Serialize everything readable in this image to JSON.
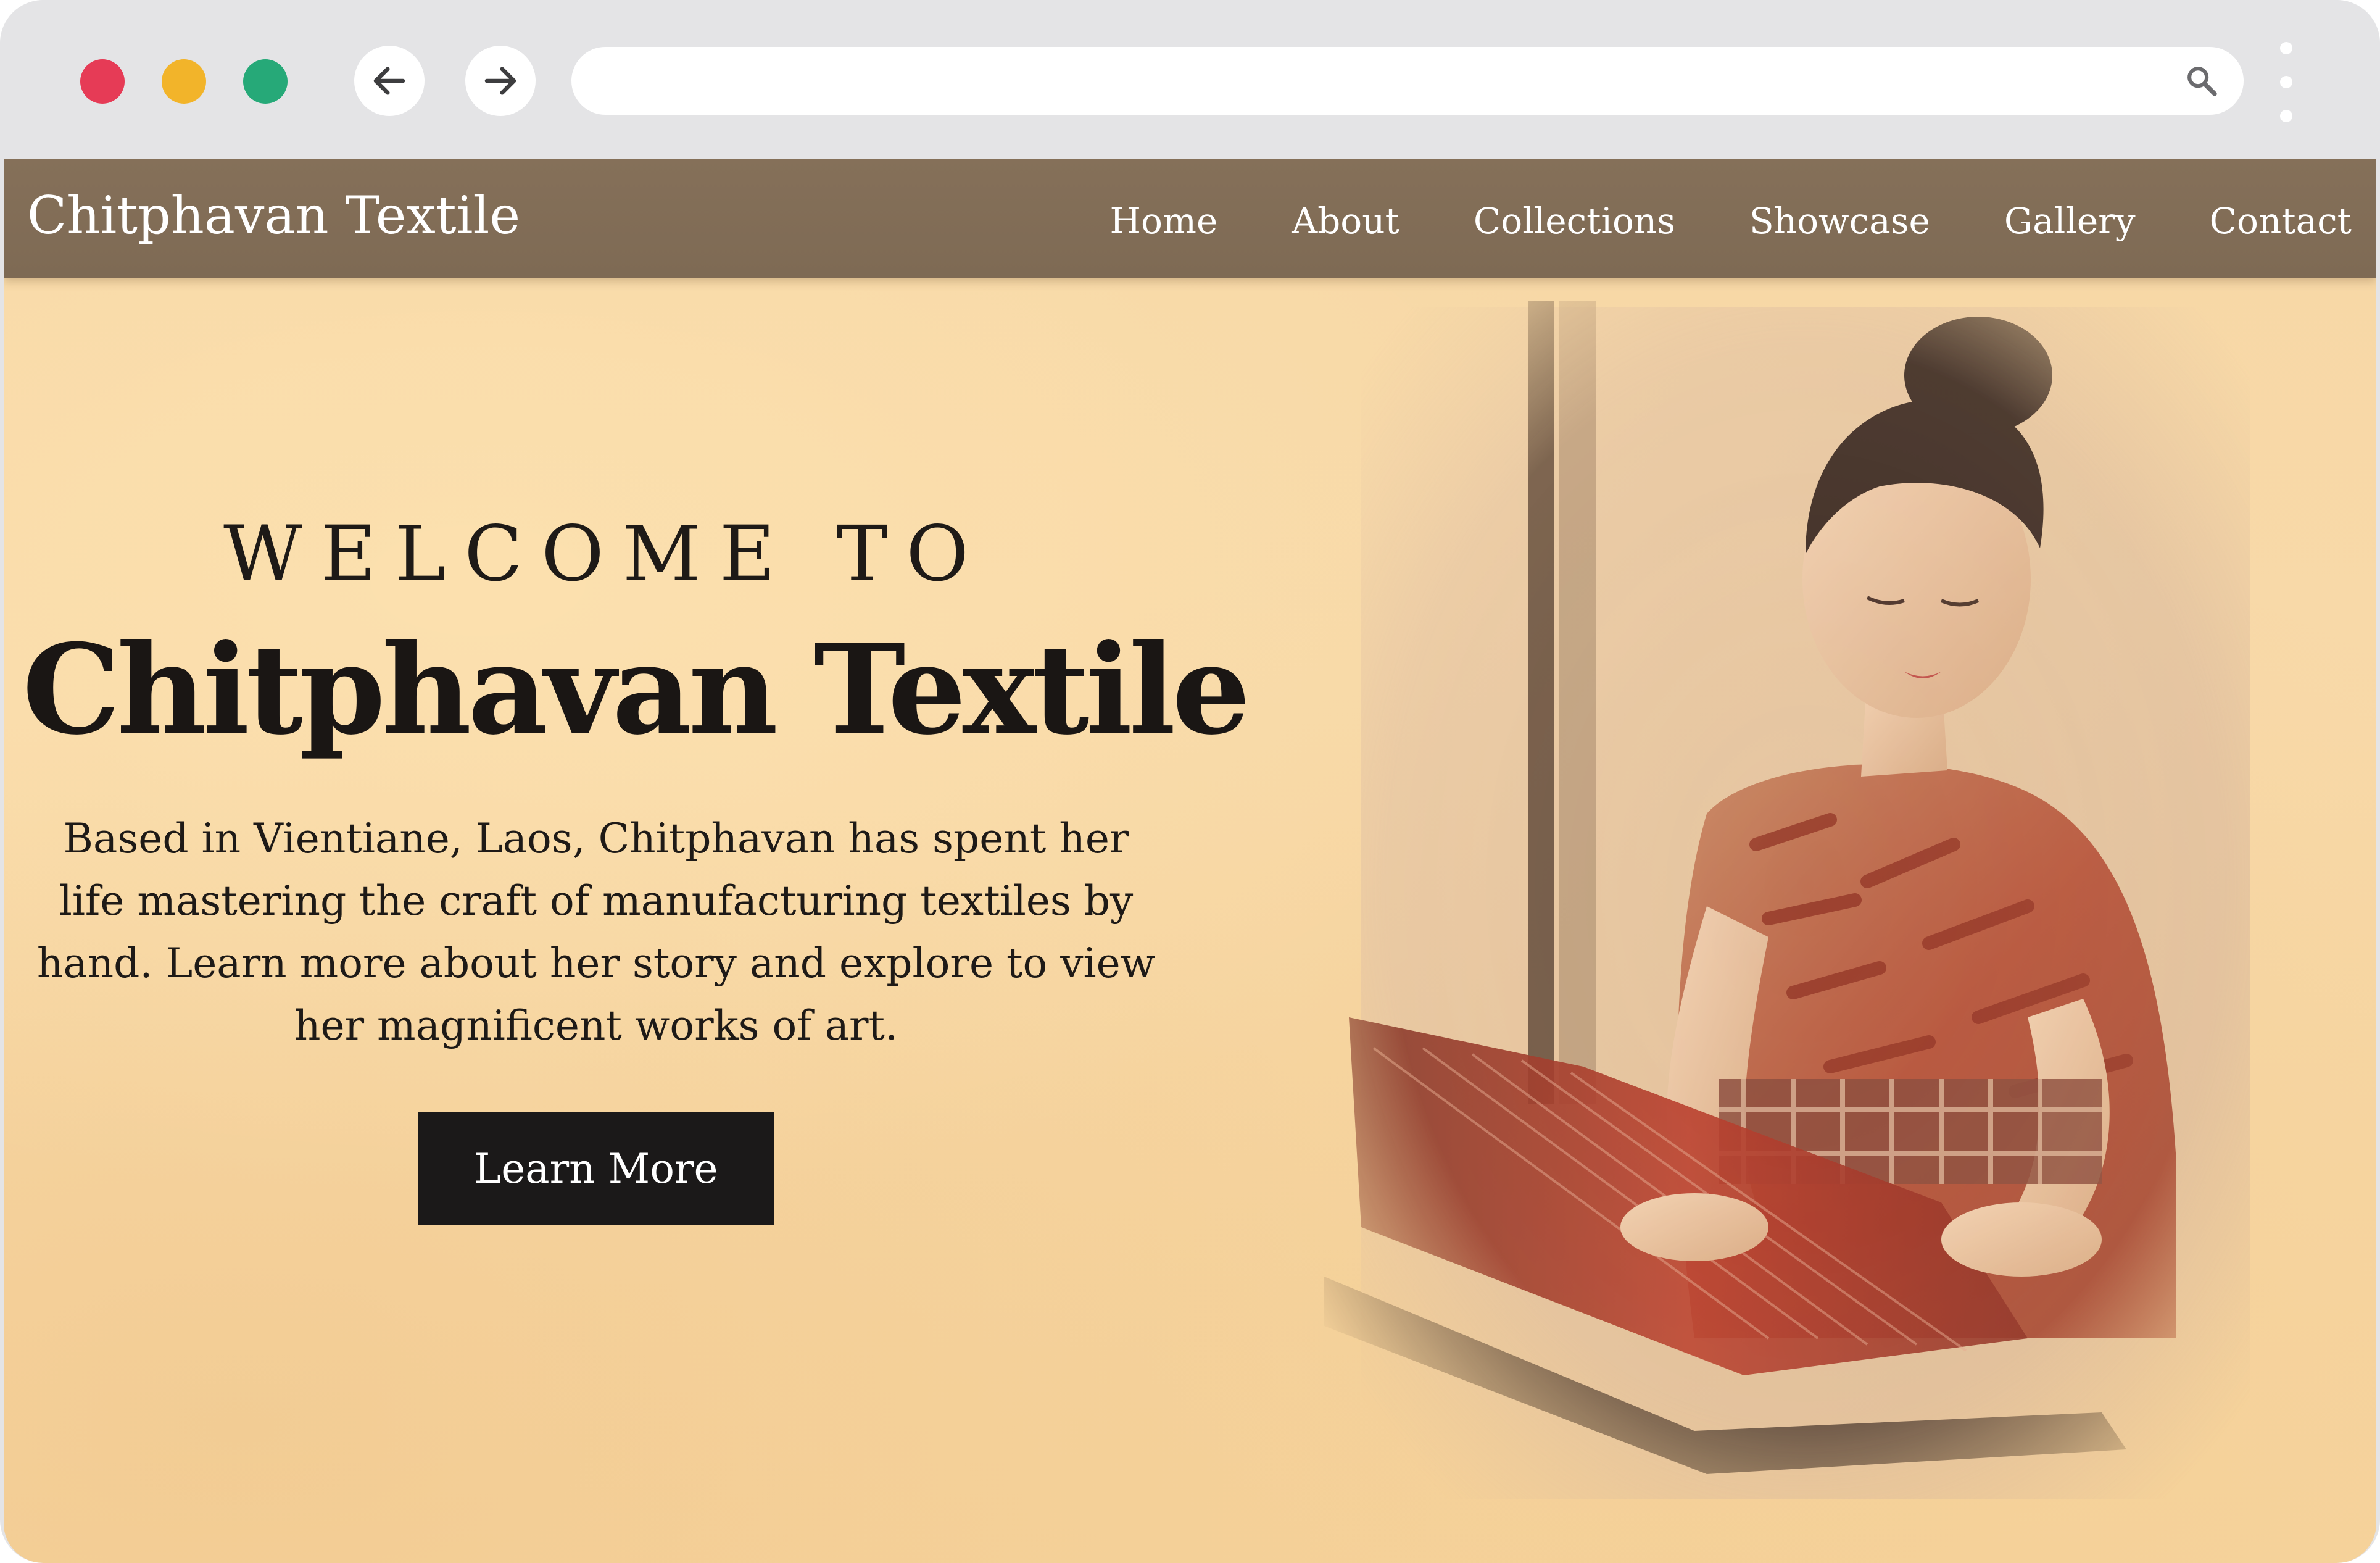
{
  "browser": {
    "address": {
      "value": ""
    }
  },
  "site": {
    "brand": "Chitphavan Textile",
    "nav": [
      {
        "label": "Home"
      },
      {
        "label": "About"
      },
      {
        "label": "Collections"
      },
      {
        "label": "Showcase"
      },
      {
        "label": "Gallery"
      },
      {
        "label": "Contact"
      }
    ]
  },
  "hero": {
    "welcome": "WELCOME TO",
    "title": "Chitphavan Textile",
    "description": "Based in Vientiane, Laos, Chitphavan has spent her life mastering the craft of manufacturing textiles by hand. Learn more about her story and explore to view her magnificent works of art.",
    "cta_label": "Learn More",
    "illustration": "painting of a woman weaving red textile at a loom"
  },
  "colors": {
    "traffic_red": "#e63b56",
    "traffic_yellow": "#f2b42a",
    "traffic_green": "#26a978",
    "header_bg": "#857059",
    "page_bg": "#f7d8a6",
    "button_bg": "#1b1919"
  },
  "icons": {
    "back": "arrow-left-icon",
    "forward": "arrow-right-icon",
    "search": "search-icon",
    "menu": "kebab-menu-icon"
  }
}
